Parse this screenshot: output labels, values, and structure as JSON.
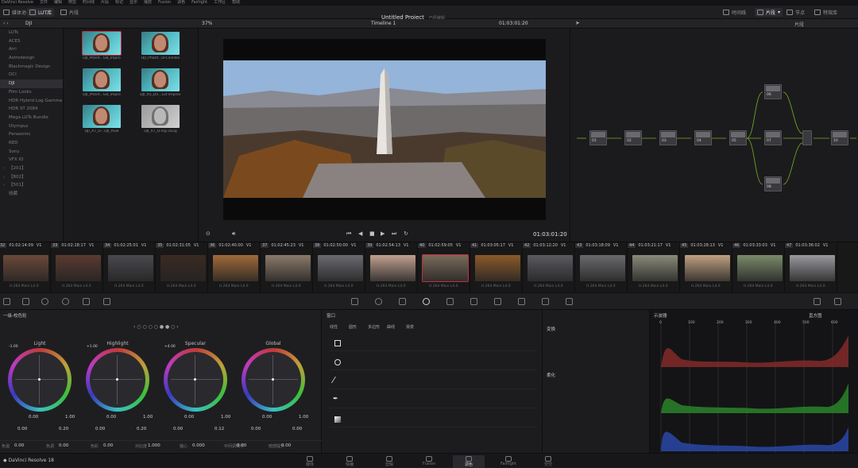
{
  "app": {
    "name": "DaVinci Resolve",
    "version_label": "DaVinci Resolve 18"
  },
  "menu": [
    "DaVinci Resolve",
    "文件",
    "编辑",
    "修剪",
    "时间线",
    "片段",
    "标记",
    "显示",
    "播放",
    "Fusion",
    "调色",
    "Fairlight",
    "工作区",
    "帮助"
  ],
  "toolbar": {
    "media_pool": "媒体池",
    "lut_library": "LUT库",
    "clip_label": "片段",
    "timeline_btn": "时间线",
    "clips_dropdown": "片段",
    "nodes": "节点",
    "effects": "特效库"
  },
  "project": {
    "title": "Untitled Project",
    "status": "已经编辑"
  },
  "lut_browser": {
    "folder": "DJI",
    "items": [
      "LUTs",
      "ACES",
      "Arri",
      "Astrodesign",
      "Blackmagic Design",
      "DCI",
      "DJI",
      "Film Looks",
      "HDR Hybrid Log Gamma",
      "HDR ST 2084",
      "Mega LUTs Bundle",
      "Olympus",
      "Panasonic",
      "RED",
      "Sony",
      "VFX IO",
      "【201】",
      "【802】",
      "【501】",
      "收藏"
    ],
    "selected": "DJI"
  },
  "lut_thumbs": [
    "DJI_Phant...GB_Impro",
    "DJI_Phant...D-Cinelike",
    "DJI_Phant...GB_Impro",
    "DJI_X5_D5...Lut Improv",
    "DJI_X7_D-..DJI_RGB",
    "DJI_X7_D-log DLog"
  ],
  "viewer": {
    "zoom": "37%",
    "timeline": "Timeline 1",
    "timecode": "01:03:01:20",
    "current_tc": "01:03:01:20"
  },
  "timeline_clips": [
    {
      "num": "32",
      "tc": "01:02:14:09",
      "v": "V1",
      "codec": "H.264 Main L4.0",
      "color": "#6a4a3a"
    },
    {
      "num": "33",
      "tc": "01:02:18:17",
      "v": "V1",
      "codec": "H.264 Main L4.0",
      "color": "#5a3a30"
    },
    {
      "num": "34",
      "tc": "01:02:25:01",
      "v": "V1",
      "codec": "H.264 Main L4.0",
      "color": "#4a4a4e"
    },
    {
      "num": "35",
      "tc": "01:02:31:05",
      "v": "V1",
      "codec": "H.264 Main L4.0",
      "color": "#3a2a22"
    },
    {
      "num": "36",
      "tc": "01:02:40:00",
      "v": "V1",
      "codec": "H.264 Main L4.0",
      "color": "#a06a3a"
    },
    {
      "num": "37",
      "tc": "01:02:45:23",
      "v": "V1",
      "codec": "H.264 Main L4.0",
      "color": "#8a7a6a"
    },
    {
      "num": "38",
      "tc": "01:02:50:00",
      "v": "V1",
      "codec": "H.264 Main L4.0",
      "color": "#6a6a70"
    },
    {
      "num": "39",
      "tc": "01:02:54:13",
      "v": "V1",
      "codec": "H.264 Main L4.0",
      "color": "#c0a090"
    },
    {
      "num": "40",
      "tc": "01:02:59:05",
      "v": "V1",
      "codec": "H.264 Main L4.0",
      "color": "#7a6a5a"
    },
    {
      "num": "41",
      "tc": "01:03:05:17",
      "v": "V1",
      "codec": "H.264 Main L4.0",
      "color": "#8a5a2a"
    },
    {
      "num": "42",
      "tc": "01:03:12:20",
      "v": "V1",
      "codec": "H.264 Main L4.0",
      "color": "#5a5a60"
    },
    {
      "num": "43",
      "tc": "01:03:18:09",
      "v": "V1",
      "codec": "H.264 Main L4.0",
      "color": "#6a6a6e"
    },
    {
      "num": "44",
      "tc": "01:03:21:17",
      "v": "V1",
      "codec": "H.264 Main L4.0",
      "color": "#8a8a7a"
    },
    {
      "num": "45",
      "tc": "01:03:28:13",
      "v": "V1",
      "codec": "H.264 Main L4.0",
      "color": "#c0a080"
    },
    {
      "num": "46",
      "tc": "01:03:33:03",
      "v": "V1",
      "codec": "H.264 Main L4.0",
      "color": "#7a8a6a"
    },
    {
      "num": "47",
      "tc": "01:03:36:02",
      "v": "V1",
      "codec": "H.264 Main L4.0",
      "color": "#9a9a9e"
    }
  ],
  "color_panel": {
    "title": "一级-校色轮",
    "wheels": [
      {
        "name": "Light",
        "val": "-1.00",
        "a": "0.00",
        "b": "0.00",
        "c": "0.20",
        "y": "1.00"
      },
      {
        "name": "Highlight",
        "val": "+1.00",
        "a": "0.00",
        "b": "0.00",
        "c": "0.20",
        "y": "1.00"
      },
      {
        "name": "Specular",
        "val": "+4.00",
        "a": "0.00",
        "b": "0.00",
        "c": "0.12",
        "y": "1.00"
      },
      {
        "name": "Global",
        "val": "",
        "a": "0.00",
        "b": "0.00",
        "c": "0.00",
        "y": "1.00"
      }
    ],
    "contrast_label": "对比度",
    "contrast": "1.000",
    "sat_label": "饱和度",
    "sat": "0.00",
    "hue_label": "色相",
    "hue": "0.00",
    "bottom": [
      {
        "k": "色温",
        "v": "0.00"
      },
      {
        "k": "色调",
        "v": "0.00"
      },
      {
        "k": "色彩",
        "v": "0.00"
      },
      {
        "k": "对比度",
        "v": "1.000"
      },
      {
        "k": "轴心",
        "v": "0.000"
      },
      {
        "k": "中间调细节",
        "v": "0.00"
      },
      {
        "k": "暗部提升",
        "v": "0.00"
      }
    ]
  },
  "windows_panel": {
    "title": "窗口",
    "tabs": [
      "线性",
      "圆形",
      "多边形",
      "曲线",
      "渐变"
    ],
    "rows": [
      "linear",
      "circle",
      "polygon",
      "curve",
      "gradient"
    ]
  },
  "transform_panel": {
    "title": "变换",
    "soften": "柔化"
  },
  "scope": {
    "title": "示波器",
    "mode": "直方图",
    "ticks": [
      "0",
      "100",
      "200",
      "300",
      "400",
      "500",
      "600"
    ]
  },
  "pages": [
    "媒体",
    "快编",
    "剪辑",
    "Fusion",
    "调色",
    "Fairlight",
    "交付"
  ],
  "active_page": "调色"
}
